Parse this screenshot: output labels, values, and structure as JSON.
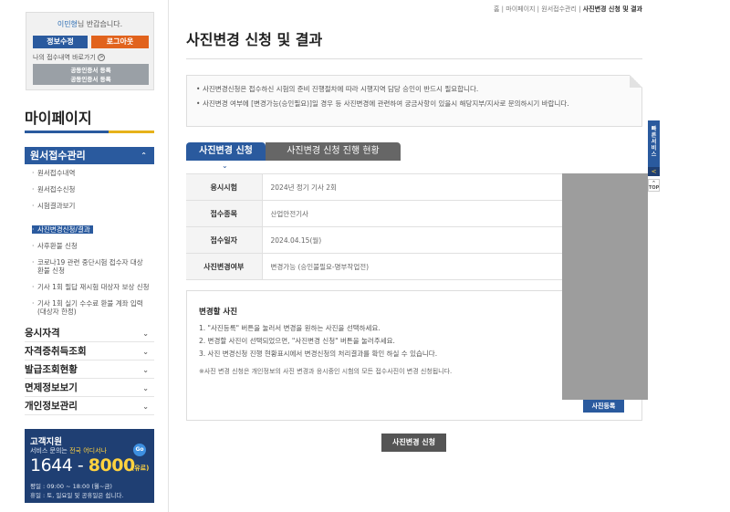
{
  "user": {
    "name": "이민형",
    "greeting_suffix": "님 반갑습니다.",
    "edit_label": "정보수정",
    "logout_label": "로그아웃",
    "shortcut_label": "나의 접수내역 바로가기",
    "shortcut_icon": ">",
    "cert_line1": "공동인증서 등록",
    "cert_line2": "공동인증서 등록"
  },
  "sidebar": {
    "title": "마이페이지",
    "active_menu": "원서접수관리",
    "submenu": [
      {
        "label": "원서접수내역"
      },
      {
        "label": "원서접수신청"
      },
      {
        "label": "시험결과보기"
      },
      {
        "label": "사진변경신청/결과"
      },
      {
        "label": "사후환불 신청"
      },
      {
        "label": "코로나19 관련 중단시험 접수자 대상 환불 신청"
      },
      {
        "label": "기사 1회 필답 재시험 대상자 보상 신청"
      },
      {
        "label": "기사 1회 실기 수수료 환불 계좌 입력(대상자 한정)"
      }
    ],
    "accordions": [
      {
        "label": "응시자격"
      },
      {
        "label": "자격증취득조회"
      },
      {
        "label": "발급조회현황"
      },
      {
        "label": "면제정보보기"
      },
      {
        "label": "개인정보관리"
      }
    ]
  },
  "support": {
    "title": "고객지원",
    "desc_prefix": "서비스 문의는 ",
    "desc_highlight": "전국 어디서나",
    "go_label": "Go",
    "phone_part1": "1644",
    "phone_dash": " - ",
    "phone_part2": "8000",
    "paid_label": "(유료)",
    "hours_weekday": "평일 : 09:00 ~ 18:00 (월~금)",
    "hours_holiday": "휴일 : 토, 일요일 및 공휴일은 쉽니다."
  },
  "breadcrumb": {
    "home": "홈",
    "level1": "마이페이지",
    "level2": "원서접수관리",
    "current": "사진변경 신청 및 결과",
    "sep": " | "
  },
  "page": {
    "title": "사진변경 신청 및 결과",
    "notices": [
      "사진변경신청은 접수하신 시험의 준비 진행절차에 따라 시행지역 담당 승인이 반드시 필요합니다.",
      "사진변경 여부에 [변경가능(승인필요)]일 경우 등 사진변경에 관련하여 궁금사항이 있을시 해당지부/지사로 문의하시기 바랍니다."
    ],
    "tab_active": "사진변경 신청",
    "tab_inactive": "사진변경 신청 진행 현황",
    "tab_arrow": "⌄"
  },
  "info": {
    "rows": [
      {
        "label": "응시시험",
        "value": "2024년 정기 기사 2회"
      },
      {
        "label": "접수종목",
        "value": "산업안전기사"
      },
      {
        "label": "접수일자",
        "value": "2024.04.15(월)"
      },
      {
        "label": "사진변경여부",
        "value": "변경가능 (승인불필요-명부작업전)"
      }
    ]
  },
  "change": {
    "title": "변경할 사진",
    "steps": [
      "1. \"사진등록\" 버튼을 눌러서 변경을 원하는 사진을 선택하세요.",
      "2. 변경할 사진이 선택되었으면, \"사진변경 신청\" 버튼을 눌러주세요.",
      "3. 사진 변경신청 진행 현황표시에서 변경신청의 처리결과를 확인 하실 수 있습니다."
    ],
    "note": "※사진 변경 신청은 개인정보의 사진 변경과 응시중인 시험의 모든 접수사진이 변경 신청됩니다.",
    "register_label": "사진등록"
  },
  "actions": {
    "apply_label": "사진변경 신청"
  },
  "quickbar": {
    "label": "빠른서비스",
    "arrow": "<",
    "top_arrow": "^",
    "top_label": "TOP"
  },
  "icons": {
    "chevron_up": "⌃",
    "chevron_down": "⌄"
  },
  "colors": {
    "primary": "#2a5a9e",
    "accent_orange": "#e1631d",
    "accent_yellow": "#e6b21a",
    "support_bg": "#1f3f73"
  }
}
